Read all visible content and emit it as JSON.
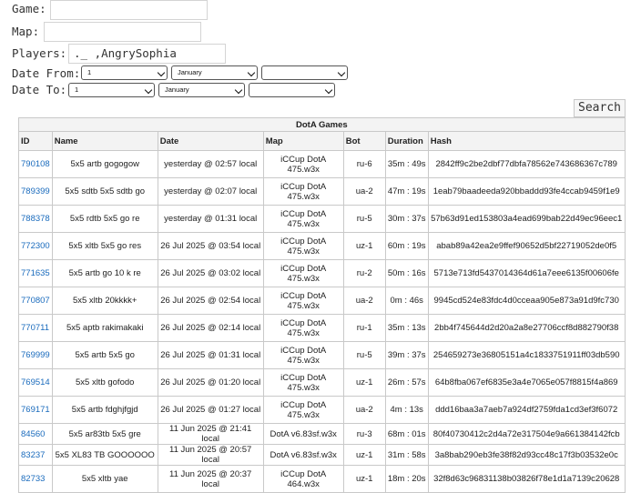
{
  "form": {
    "game_label": "Game:",
    "game_value": "",
    "map_label": "Map:",
    "map_value": "",
    "players_label": "Players:",
    "players_value": "._ ,AngrySophia",
    "date_from_label": "Date From:",
    "date_to_label": "Date To:",
    "date_from": {
      "day": "1",
      "month": "January",
      "year": ""
    },
    "date_to": {
      "day": "1",
      "month": "January",
      "year": ""
    },
    "search_label": "Search"
  },
  "table": {
    "caption": "DotA Games",
    "columns": [
      "ID",
      "Name",
      "Date",
      "Map",
      "Bot",
      "Duration",
      "Hash"
    ],
    "rows": [
      {
        "id": "790108",
        "name": "5x5 artb gogogow",
        "date": "yesterday @ 02:57 local",
        "map": [
          "iCCup DotA",
          "475.w3x"
        ],
        "bot": "ru-6",
        "duration": "35m : 49s",
        "hash": "2842ff9c2be2dbf77dbfa78562e743686367c789"
      },
      {
        "id": "789399",
        "name": "5x5 sdtb 5x5 sdtb go",
        "date": "yesterday @ 02:07 local",
        "map": [
          "iCCup DotA",
          "475.w3x"
        ],
        "bot": "ua-2",
        "duration": "47m : 19s",
        "hash": "1eab79baadeeda920bbaddd93fe4ccab9459f1e9"
      },
      {
        "id": "788378",
        "name": "5x5 rdtb 5x5 go re",
        "date": "yesterday @ 01:31 local",
        "map": [
          "iCCup DotA",
          "475.w3x"
        ],
        "bot": "ru-5",
        "duration": "30m : 37s",
        "hash": "57b63d91ed153803a4ead699bab22d49ec96eec1"
      },
      {
        "id": "772300",
        "name": "5x5 xltb 5x5 go res",
        "date": "26 Jul 2025 @ 03:54 local",
        "map": [
          "iCCup DotA",
          "475.w3x"
        ],
        "bot": "uz-1",
        "duration": "60m : 19s",
        "hash": "abab89a42ea2e9ffef90652d5bf22719052de0f5"
      },
      {
        "id": "771635",
        "name": "5x5 artb go 10 k re",
        "date": "26 Jul 2025 @ 03:02 local",
        "map": [
          "iCCup DotA",
          "475.w3x"
        ],
        "bot": "ru-2",
        "duration": "50m : 16s",
        "hash": "5713e713fd5437014364d61a7eee6135f00606fe"
      },
      {
        "id": "770807",
        "name": "5x5 xltb 20kkkk+",
        "date": "26 Jul 2025 @ 02:54 local",
        "map": [
          "iCCup DotA",
          "475.w3x"
        ],
        "bot": "ua-2",
        "duration": "0m : 46s",
        "hash": "9945cd524e83fdc4d0cceaa905e873a91d9fc730"
      },
      {
        "id": "770711",
        "name": "5x5 aptb rakimakaki",
        "date": "26 Jul 2025 @ 02:14 local",
        "map": [
          "iCCup DotA",
          "475.w3x"
        ],
        "bot": "ru-1",
        "duration": "35m : 13s",
        "hash": "2bb4f745644d2d20a2a8e27706ccf8d882790f38"
      },
      {
        "id": "769999",
        "name": "5x5 artb 5x5 go",
        "date": "26 Jul 2025 @ 01:31 local",
        "map": [
          "iCCup DotA",
          "475.w3x"
        ],
        "bot": "ru-5",
        "duration": "39m : 37s",
        "hash": "254659273e36805151a4c1833751911ff03db590"
      },
      {
        "id": "769514",
        "name": "5x5 xltb gofodo",
        "date": "26 Jul 2025 @ 01:20 local",
        "map": [
          "iCCup DotA",
          "475.w3x"
        ],
        "bot": "uz-1",
        "duration": "26m : 57s",
        "hash": "64b8fba067ef6835e3a4e7065e057f8815f4a869"
      },
      {
        "id": "769171",
        "name": "5x5 artb fdghjfgjd",
        "date": "26 Jul 2025 @ 01:27 local",
        "map": [
          "iCCup DotA",
          "475.w3x"
        ],
        "bot": "ua-2",
        "duration": "4m : 13s",
        "hash": "ddd16baa3a7aeb7a924df2759fda1cd3ef3f6072"
      },
      {
        "id": "84560",
        "name": "5x5 ar83tb 5x5 gre",
        "date": "11 Jun 2025 @ 21:41 local",
        "map": [
          "DotA v6.83sf.w3x"
        ],
        "bot": "ru-3",
        "duration": "68m : 01s",
        "hash": "80f40730412c2d4a72e317504e9a661384142fcb"
      },
      {
        "id": "83237",
        "name": "5x5 XL83 TB GOOOOOO",
        "date": "11 Jun 2025 @ 20:57 local",
        "map": [
          "DotA v6.83sf.w3x"
        ],
        "bot": "uz-1",
        "duration": "31m : 58s",
        "hash": "3a8bab290eb3fe38f82d93cc48c17f3b03532e0c"
      },
      {
        "id": "82733",
        "name": "5x5 xltb yae",
        "date": "11 Jun 2025 @ 20:37 local",
        "map": [
          "iCCup DotA",
          "464.w3x"
        ],
        "bot": "uz-1",
        "duration": "18m : 20s",
        "hash": "32f8d63c96831138b03826f78e1d1a7139c20628"
      }
    ]
  }
}
